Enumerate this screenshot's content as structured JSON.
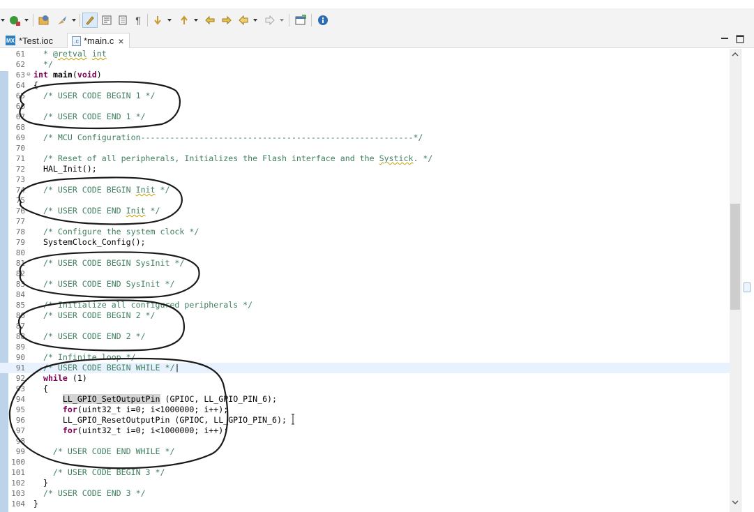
{
  "tabs": [
    {
      "icon": "MX",
      "label": "*Test.ioc"
    },
    {
      "icon": ".c",
      "label": "*main.c",
      "close": "×"
    }
  ],
  "editor_lines": [
    {
      "n": "61",
      "html": "  <span class=\"c\">* @<span class=\"sq\">retval</span> <span class=\"sq\">int</span></span>"
    },
    {
      "n": "62",
      "html": "  <span class=\"c\">*/</span>"
    },
    {
      "n": "63",
      "fold": "⊖",
      "html": "<span class=\"kw\">int</span> <b>main</b>(<span class=\"kw\">void</span>)"
    },
    {
      "n": "64",
      "html": "{"
    },
    {
      "n": "65",
      "html": "  <span class=\"c\">/* USER CODE BEGIN 1 */</span>"
    },
    {
      "n": "66",
      "html": ""
    },
    {
      "n": "67",
      "html": "  <span class=\"c\">/* USER CODE END 1 */</span>"
    },
    {
      "n": "68",
      "html": ""
    },
    {
      "n": "69",
      "html": "  <span class=\"c\">/* MCU Configuration--------------------------------------------------------*/</span>"
    },
    {
      "n": "70",
      "html": ""
    },
    {
      "n": "71",
      "html": "  <span class=\"c\">/* Reset of all peripherals, Initializes the Flash interface and the <span class=\"sq\">Systick</span>. */</span>"
    },
    {
      "n": "72",
      "html": "  HAL_Init();"
    },
    {
      "n": "73",
      "html": ""
    },
    {
      "n": "74",
      "html": "  <span class=\"c\">/* USER CODE BEGIN <span class=\"sq\">Init</span> */</span>"
    },
    {
      "n": "75",
      "html": ""
    },
    {
      "n": "76",
      "html": "  <span class=\"c\">/* USER CODE END <span class=\"sq\">Init</span> */</span>"
    },
    {
      "n": "77",
      "html": ""
    },
    {
      "n": "78",
      "html": "  <span class=\"c\">/* Configure the system clock */</span>"
    },
    {
      "n": "79",
      "html": "  SystemClock_Config();"
    },
    {
      "n": "80",
      "html": ""
    },
    {
      "n": "81",
      "html": "  <span class=\"c\">/* USER CODE BEGIN SysInit */</span>"
    },
    {
      "n": "82",
      "html": ""
    },
    {
      "n": "83",
      "html": "  <span class=\"c\">/* USER CODE END SysInit */</span>"
    },
    {
      "n": "84",
      "html": ""
    },
    {
      "n": "85",
      "html": "  <span class=\"c\">/* Initialize all configured peripherals */</span>"
    },
    {
      "n": "86",
      "html": "  <span class=\"c\">/* USER CODE BEGIN 2 */</span>"
    },
    {
      "n": "87",
      "html": ""
    },
    {
      "n": "88",
      "html": "  <span class=\"c\">/* USER CODE END 2 */</span>"
    },
    {
      "n": "89",
      "html": ""
    },
    {
      "n": "90",
      "html": "  <span class=\"c\">/* Infinite loop */</span>"
    },
    {
      "n": "91",
      "current": true,
      "html": "  <span class=\"c\">/* USER CODE BEGIN WHILE */</span>|"
    },
    {
      "n": "92",
      "html": "  <span class=\"kw\">while</span> (1)"
    },
    {
      "n": "93",
      "html": "  {"
    },
    {
      "n": "94",
      "html": "      <span class=\"hl\">LL_GPIO_SetOutputPin</span> (GPIOC, LL_GPIO_PIN_6);"
    },
    {
      "n": "95",
      "html": "      <span class=\"kw\">for</span>(uint32_t i=0; i&lt;1000000; i++);"
    },
    {
      "n": "96",
      "html": "      LL_GPIO_ResetOutputPin (GPIOC, LL_GPIO_PIN_6);"
    },
    {
      "n": "97",
      "html": "      <span class=\"kw\">for</span>(uint32_t i=0; i&lt;1000000; i++);"
    },
    {
      "n": "98",
      "html": ""
    },
    {
      "n": "99",
      "html": "    <span class=\"c\">/* USER CODE END WHILE */</span>"
    },
    {
      "n": "100",
      "html": ""
    },
    {
      "n": "101",
      "html": "    <span class=\"c\">/* USER CODE BEGIN 3 */</span>"
    },
    {
      "n": "102",
      "html": "  }"
    },
    {
      "n": "103",
      "html": "  <span class=\"c\">/* USER CODE END 3 */</span>"
    },
    {
      "n": "104",
      "html": "}"
    }
  ]
}
